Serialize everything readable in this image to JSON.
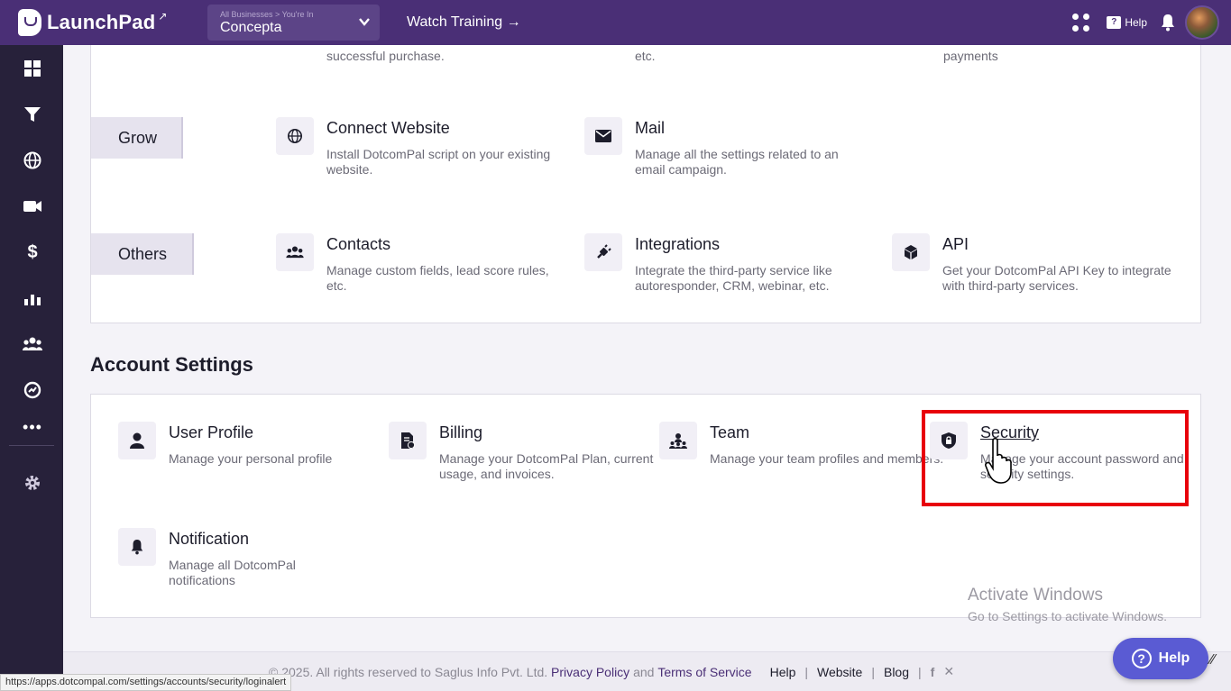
{
  "app": {
    "name": "LaunchPad"
  },
  "business": {
    "caption": "All Businesses > You're In",
    "name": "Concepta"
  },
  "topbar": {
    "watch_training": "Watch Training →",
    "help": "Help"
  },
  "top_partial": [
    {
      "desc": "successful purchase."
    },
    {
      "desc": "etc."
    },
    {
      "desc": "payments"
    }
  ],
  "categories": [
    {
      "label": "Grow",
      "cards": [
        {
          "title": "Connect Website",
          "desc": "Install DotcomPal script on your existing website.",
          "icon": "globe-icon"
        },
        {
          "title": "Mail",
          "desc": "Manage all the settings related to an email campaign.",
          "icon": "envelope-icon"
        }
      ]
    },
    {
      "label": "Others",
      "cards": [
        {
          "title": "Contacts",
          "desc": "Manage custom fields, lead score rules, etc.",
          "icon": "users-icon"
        },
        {
          "title": "Integrations",
          "desc": "Integrate the third-party service like autoresponder, CRM, webinar, etc.",
          "icon": "plug-icon"
        },
        {
          "title": "API",
          "desc": "Get your DotcomPal API Key to integrate with third-party services.",
          "icon": "cube-icon"
        }
      ]
    }
  ],
  "account_settings": {
    "title": "Account Settings",
    "cards": [
      {
        "title": "User Profile",
        "desc": "Manage your personal profile",
        "icon": "user-icon"
      },
      {
        "title": "Billing",
        "desc": "Manage your DotcomPal Plan, current usage, and invoices.",
        "icon": "invoice-icon"
      },
      {
        "title": "Team",
        "desc": "Manage your team profiles and members.",
        "icon": "team-icon"
      },
      {
        "title": "Security",
        "desc": "Manage your account password and security settings.",
        "icon": "shield-lock-icon"
      },
      {
        "title": "Notification",
        "desc": "Manage all DotcomPal notifications",
        "icon": "bell-icon"
      }
    ]
  },
  "watermark": {
    "line1": "Activate Windows",
    "line2": "Go to Settings to activate Windows."
  },
  "footer": {
    "copyright": "© 2025. All rights reserved to Saglus Info Pvt. Ltd.",
    "privacy": "Privacy Policy",
    "and": "and",
    "terms": "Terms of Service",
    "help": "Help",
    "website": "Website",
    "blog": "Blog",
    "separator": "|"
  },
  "help_button": "Help",
  "status_url": "https://apps.dotcompal.com/settings/accounts/security/loginalert",
  "colors": {
    "topbar": "#4a2f76",
    "sidebar": "#27213a",
    "highlight": "#e8000b",
    "help_button": "#5a5bd3"
  }
}
